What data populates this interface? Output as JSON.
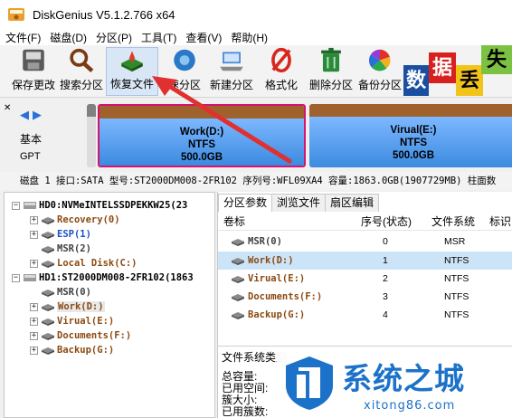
{
  "window": {
    "title": "DiskGenius V5.1.2.766 x64"
  },
  "menu": [
    "文件(F)",
    "磁盘(D)",
    "分区(P)",
    "工具(T)",
    "查看(V)",
    "帮助(H)"
  ],
  "toolbar": [
    {
      "label": "保存更改",
      "icon": "save-icon"
    },
    {
      "label": "搜索分区",
      "icon": "search-partition-icon"
    },
    {
      "label": "恢复文件",
      "icon": "recover-files-icon"
    },
    {
      "label": "速分区",
      "icon": "quick-partition-icon"
    },
    {
      "label": "新建分区",
      "icon": "new-partition-icon"
    },
    {
      "label": "格式化",
      "icon": "format-icon"
    },
    {
      "label": "删除分区",
      "icon": "delete-partition-icon"
    },
    {
      "label": "备份分区",
      "icon": "backup-partition-icon"
    }
  ],
  "promo_tiles": [
    "数",
    "据",
    "丢",
    "失"
  ],
  "diskmap": {
    "basic_label": "基本",
    "gpt_label": "GPT",
    "partitions": [
      {
        "name": "Work(D:)",
        "fs": "NTFS",
        "size": "500.0GB",
        "selected": true
      },
      {
        "name": "Virual(E:)",
        "fs": "NTFS",
        "size": "500.0GB",
        "selected": false
      }
    ]
  },
  "disk_info": "磁盘 1 接口:SATA  型号:ST2000DM008-2FR102  序列号:WFL09XA4  容量:1863.0GB(1907729MB)  柱面数",
  "tree": {
    "nodes": [
      {
        "text": "HD0:NVMeINTELSSDPEKKW25(23",
        "level": 0,
        "kind": "disk",
        "expander": "minus"
      },
      {
        "text": "Recovery(0)",
        "level": 1,
        "kind": "part",
        "expander": "plus",
        "color": "#8b4a12"
      },
      {
        "text": "ESP(1)",
        "level": 1,
        "kind": "part",
        "expander": "plus",
        "color": "#1a50c8"
      },
      {
        "text": "MSR(2)",
        "level": 1,
        "kind": "part",
        "expander": "none",
        "color": "#404040"
      },
      {
        "text": "Local Disk(C:)",
        "level": 1,
        "kind": "part",
        "expander": "plus",
        "color": "#8b4a12"
      },
      {
        "text": "HD1:ST2000DM008-2FR102(1863",
        "level": 0,
        "kind": "disk",
        "expander": "minus"
      },
      {
        "text": "MSR(0)",
        "level": 1,
        "kind": "part",
        "expander": "none",
        "color": "#404040"
      },
      {
        "text": "Work(D:)",
        "level": 1,
        "kind": "part",
        "expander": "plus",
        "color": "#8b4a12",
        "selected": true
      },
      {
        "text": "Virual(E:)",
        "level": 1,
        "kind": "part",
        "expander": "plus",
        "color": "#8b4a12"
      },
      {
        "text": "Documents(F:)",
        "level": 1,
        "kind": "part",
        "expander": "plus",
        "color": "#8b4a12"
      },
      {
        "text": "Backup(G:)",
        "level": 1,
        "kind": "part",
        "expander": "plus",
        "color": "#8b4a12"
      }
    ]
  },
  "tabs": [
    "分区参数",
    "浏览文件",
    "扇区编辑"
  ],
  "partition_table": {
    "columns": [
      "卷标",
      "序号(状态)",
      "文件系统",
      "标识"
    ],
    "rows": [
      {
        "label": "MSR(0)",
        "index": "0",
        "fs": "MSR",
        "color": "#404040"
      },
      {
        "label": "Work(D:)",
        "index": "1",
        "fs": "NTFS",
        "color": "#8b4a12",
        "selected": true
      },
      {
        "label": "Virual(E:)",
        "index": "2",
        "fs": "NTFS",
        "color": "#8b4a12"
      },
      {
        "label": "Documents(F:)",
        "index": "3",
        "fs": "NTFS",
        "color": "#8b4a12"
      },
      {
        "label": "Backup(G:)",
        "index": "4",
        "fs": "NTFS",
        "color": "#8b4a12"
      }
    ]
  },
  "fs_info": {
    "heading": "文件系统类型:",
    "total": "总容量:",
    "used": "已用空间:",
    "cluster": "簇大小:",
    "used_clusters": "已用簇数:"
  },
  "watermark": {
    "title": "系统之城",
    "url": "xitong86.com"
  },
  "colors": {
    "accent": "#1b72c8",
    "selection": "#cce4f7",
    "partition_border": "#d4146e",
    "arrow": "#e03030"
  }
}
